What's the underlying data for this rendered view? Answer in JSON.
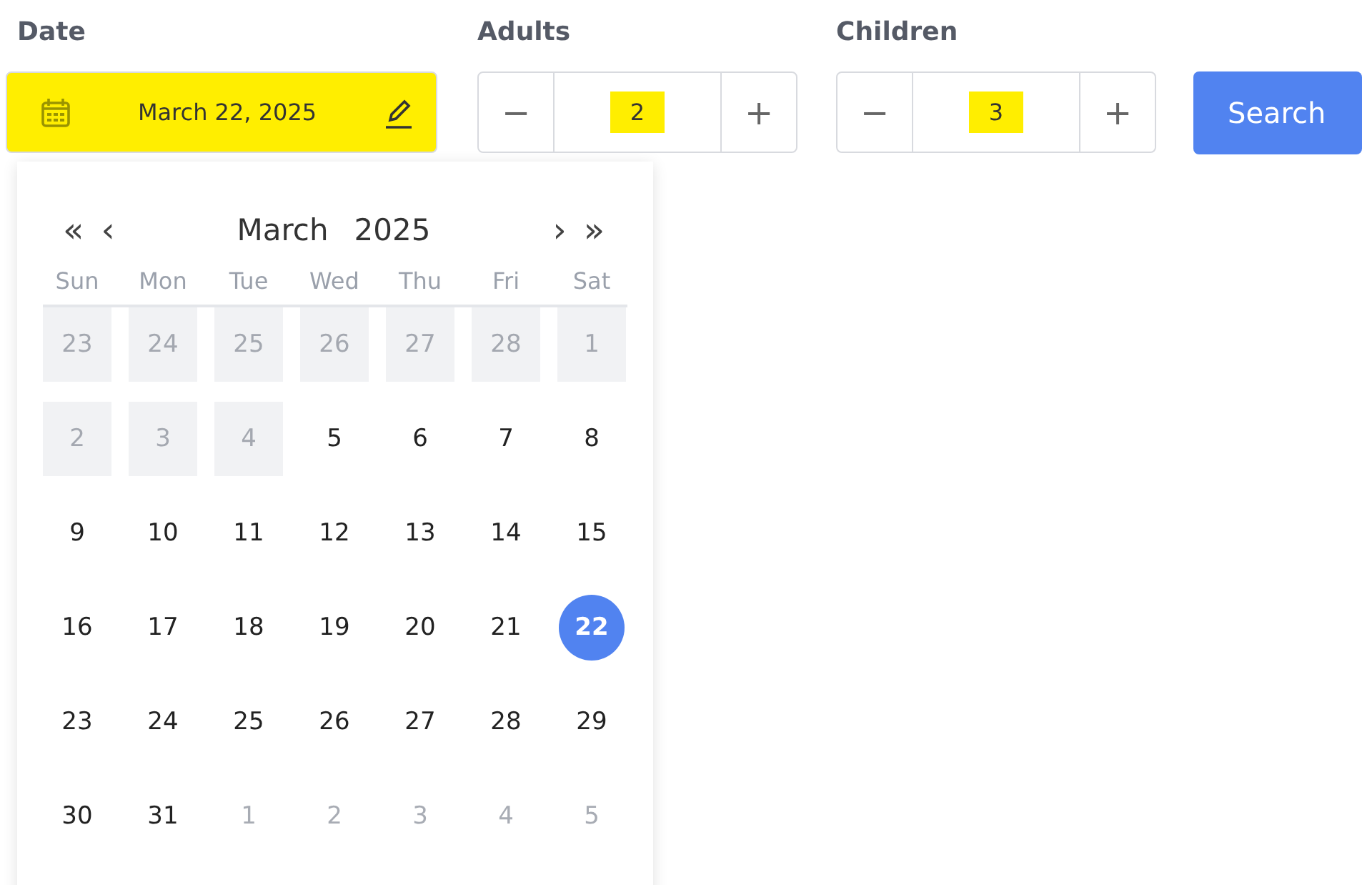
{
  "date_field": {
    "label": "Date",
    "value": "March 22, 2025",
    "highlighted": true
  },
  "steppers": [
    {
      "label": "Adults",
      "minus": "−",
      "value": "2",
      "plus": "+",
      "highlighted": true
    },
    {
      "label": "Children",
      "minus": "−",
      "value": "3",
      "plus": "+",
      "highlighted": true
    }
  ],
  "search_button": "Search",
  "calendar": {
    "prev_year": "«",
    "prev_month": "‹",
    "month": "March",
    "year": "2025",
    "next_month": "›",
    "next_year": "»",
    "weekdays": [
      "Sun",
      "Mon",
      "Tue",
      "Wed",
      "Thu",
      "Fri",
      "Sat"
    ],
    "weeks": [
      [
        {
          "day": "23",
          "kind": "disabled",
          "selected": false
        },
        {
          "day": "24",
          "kind": "disabled",
          "selected": false
        },
        {
          "day": "25",
          "kind": "disabled",
          "selected": false
        },
        {
          "day": "26",
          "kind": "disabled",
          "selected": false
        },
        {
          "day": "27",
          "kind": "disabled",
          "selected": false
        },
        {
          "day": "28",
          "kind": "disabled",
          "selected": false
        },
        {
          "day": "1",
          "kind": "disabled",
          "selected": false
        }
      ],
      [
        {
          "day": "2",
          "kind": "disabled",
          "selected": false
        },
        {
          "day": "3",
          "kind": "disabled",
          "selected": false
        },
        {
          "day": "4",
          "kind": "disabled",
          "selected": false
        },
        {
          "day": "5",
          "kind": "current",
          "selected": false
        },
        {
          "day": "6",
          "kind": "current",
          "selected": false
        },
        {
          "day": "7",
          "kind": "current",
          "selected": false
        },
        {
          "day": "8",
          "kind": "current",
          "selected": false
        }
      ],
      [
        {
          "day": "9",
          "kind": "current",
          "selected": false
        },
        {
          "day": "10",
          "kind": "current",
          "selected": false
        },
        {
          "day": "11",
          "kind": "current",
          "selected": false
        },
        {
          "day": "12",
          "kind": "current",
          "selected": false
        },
        {
          "day": "13",
          "kind": "current",
          "selected": false
        },
        {
          "day": "14",
          "kind": "current",
          "selected": false
        },
        {
          "day": "15",
          "kind": "current",
          "selected": false
        }
      ],
      [
        {
          "day": "16",
          "kind": "current",
          "selected": false
        },
        {
          "day": "17",
          "kind": "current",
          "selected": false
        },
        {
          "day": "18",
          "kind": "current",
          "selected": false
        },
        {
          "day": "19",
          "kind": "current",
          "selected": false
        },
        {
          "day": "20",
          "kind": "current",
          "selected": false
        },
        {
          "day": "21",
          "kind": "current",
          "selected": false
        },
        {
          "day": "22",
          "kind": "current",
          "selected": true
        }
      ],
      [
        {
          "day": "23",
          "kind": "current",
          "selected": false
        },
        {
          "day": "24",
          "kind": "current",
          "selected": false
        },
        {
          "day": "25",
          "kind": "current",
          "selected": false
        },
        {
          "day": "26",
          "kind": "current",
          "selected": false
        },
        {
          "day": "27",
          "kind": "current",
          "selected": false
        },
        {
          "day": "28",
          "kind": "current",
          "selected": false
        },
        {
          "day": "29",
          "kind": "current",
          "selected": false
        }
      ],
      [
        {
          "day": "30",
          "kind": "current",
          "selected": false
        },
        {
          "day": "31",
          "kind": "current",
          "selected": false
        },
        {
          "day": "1",
          "kind": "outside",
          "selected": false
        },
        {
          "day": "2",
          "kind": "outside",
          "selected": false
        },
        {
          "day": "3",
          "kind": "outside",
          "selected": false
        },
        {
          "day": "4",
          "kind": "outside",
          "selected": false
        },
        {
          "day": "5",
          "kind": "outside",
          "selected": false
        }
      ]
    ]
  }
}
